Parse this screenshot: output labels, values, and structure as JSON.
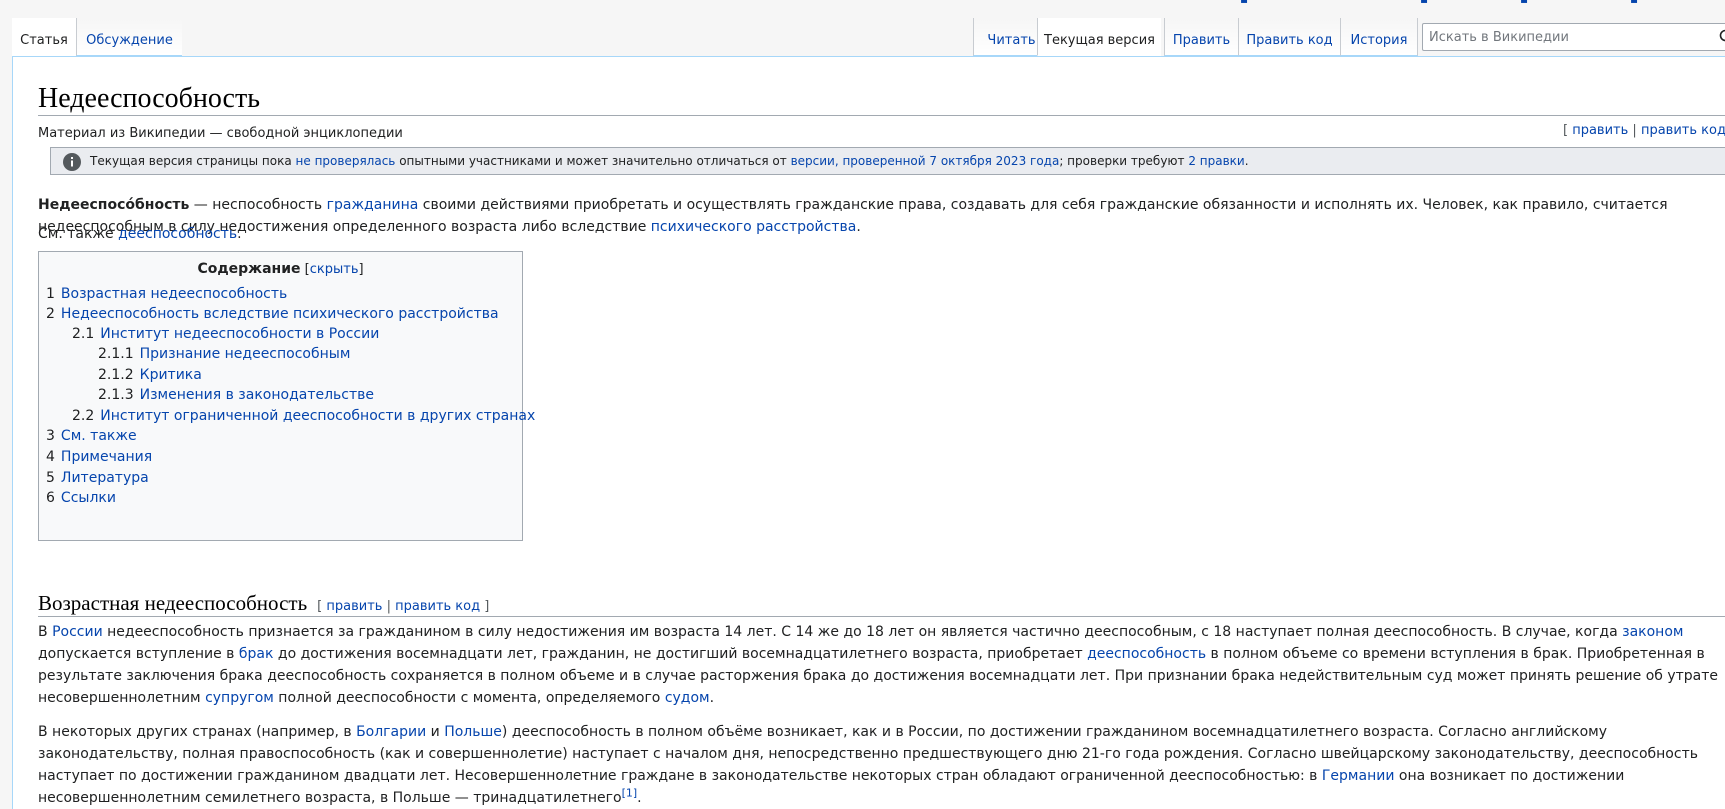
{
  "tabs": {
    "left": [
      "Статья",
      "Обсуждение"
    ],
    "right": [
      "Читать",
      "Текущая версия",
      "Править",
      "Править код",
      "История"
    ]
  },
  "search": {
    "placeholder": "Искать в Википедии"
  },
  "article": {
    "title": "Недееспособность",
    "site_sub": "Материал из Википедии — свободной энциклопедии",
    "edit_links": {
      "open": "[",
      "edit": "править",
      "sep": "|",
      "edit_code": "править код",
      "close": "]"
    }
  },
  "notice": {
    "t1": "Текущая версия страницы пока ",
    "l1": "не проверялась",
    "t2": " опытными участниками и может значительно отличаться от ",
    "l2": "версии, проверенной 7 октября 2023 года",
    "t3": "; проверки требуют ",
    "l3": "2 правки",
    "t4": "."
  },
  "intro": {
    "bold": "Недееспосо́бность",
    "t1": " — неспособность ",
    "l1": "гражданина",
    "t2": " своими действиями приобретать и осуществлять гражданские права, создавать для себя гражданские обязанности и исполнять их. Человек, как правило, считается недееспособным в силу недостижения определенного возраста либо вследствие ",
    "l2": "психического расстройства",
    "t3": "."
  },
  "see_also_line": {
    "t1": "См. также ",
    "l1": "дееспособность",
    "t2": "."
  },
  "toc": {
    "title": "Содержание",
    "toggle_open": " [",
    "toggle": "скрыть",
    "toggle_close": "]",
    "items": [
      {
        "num": "1",
        "label": "Возрастная недееспособность"
      },
      {
        "num": "2",
        "label": "Недееспособность вследствие психического расстройства"
      },
      {
        "num": "2.1",
        "label": "Институт недееспособности в России"
      },
      {
        "num": "2.1.1",
        "label": "Признание недееспособным"
      },
      {
        "num": "2.1.2",
        "label": "Критика"
      },
      {
        "num": "2.1.3",
        "label": "Изменения в законодательстве"
      },
      {
        "num": "2.2",
        "label": "Институт ограниченной дееспособности в других странах"
      },
      {
        "num": "3",
        "label": "См. также"
      },
      {
        "num": "4",
        "label": "Примечания"
      },
      {
        "num": "5",
        "label": "Литература"
      },
      {
        "num": "6",
        "label": "Ссылки"
      }
    ]
  },
  "section1": {
    "heading": "Возрастная недееспособность",
    "p1": {
      "t1": "В ",
      "l1": "России",
      "t2": " недееспособность признается за гражданином в силу недостижения им возраста 14 лет. С 14 же до 18 лет он является частично дееспособным, с 18 наступает полная дееспособность. В случае, когда ",
      "l2": "законом",
      "t3": " допускается вступление в ",
      "l3": "брак",
      "t4": " до достижения восемнадцати лет, гражданин, не достигший восемнадцатилетнего возраста, приобретает ",
      "l4": "дееспособность",
      "t5": " в полном объеме со времени вступления в брак. Приобретенная в результате заключения брака дееспособность сохраняется в полном объеме и в случае расторжения брака до достижения восемнадцати лет. При признании брака недействительным суд может принять решение об утрате несовершеннолетним ",
      "l5": "супругом",
      "t6": " полной дееспособности с момента, определяемого ",
      "l6": "судом",
      "t7": "."
    },
    "p2": {
      "t1": "В некоторых других странах (например, в ",
      "l1": "Болгарии",
      "t2": " и ",
      "l2": "Польше",
      "t3": ") дееспособность в полном объёме возникает, как и в России, по достижении гражданином восемнадцатилетнего возраста. Согласно английскому законодательству, полная правоспособность (как и совершеннолетие) наступает с началом дня, непосредственно предшествующего дню 21-го года рождения. Согласно швейцарскому законодательству, дееспособность наступает по достижении гражданином двадцати лет. Несовершеннолетние граждане в законодательстве некоторых стран обладают ограниченной дееспособностью: в ",
      "l3": "Германии",
      "t4": " она возникает по достижении несовершеннолетним семилетнего возраста, в Польше — тринадцатилетнего",
      "ref": "[1]",
      "t5": "."
    }
  }
}
